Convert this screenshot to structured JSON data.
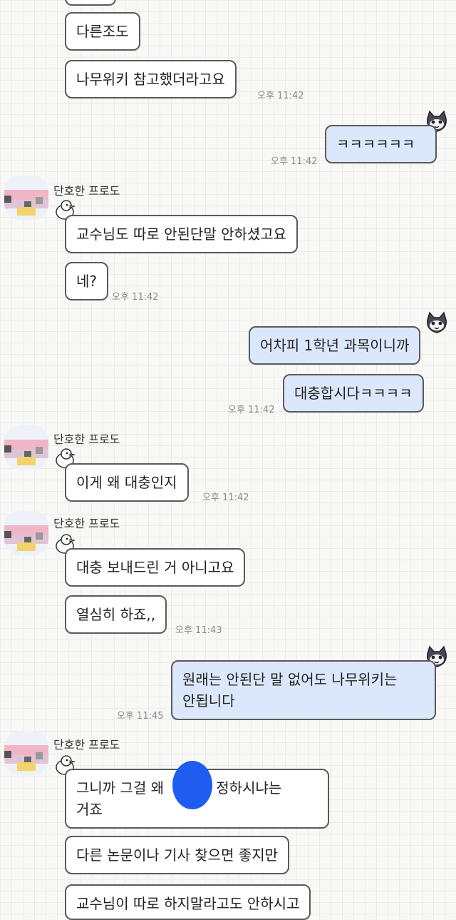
{
  "sender_name": "단호한 프로도",
  "messages": [
    {
      "text": "다른조도"
    },
    {
      "text": "나무위키 참고했더라고요",
      "time": "오후 11:42"
    },
    {
      "text": "ㅋㅋㅋㅋㅋㅋ",
      "time": "오후 11:42"
    },
    {
      "text": "교수님도 따로 안된단말 안하셨고요"
    },
    {
      "text": "네?",
      "time": "오후 11:42"
    },
    {
      "text": "어차피 1학년 과목이니까"
    },
    {
      "text": "대충합시다ㅋㅋㅋㅋ",
      "time": "오후 11:42"
    },
    {
      "text": "이게 왜 대충인지",
      "time": "오후 11:42"
    },
    {
      "text": "대충 보내드린 거 아니고요"
    },
    {
      "text": "열심히 하죠,,",
      "time": "오후 11:43"
    },
    {
      "text1": "원래는 안된단 말 없어도 나무위키는",
      "text2": "안됩니다",
      "time": "오후 11:45"
    },
    {
      "text1": "그니까 그걸 왜",
      "text1b": "님이 정하시냐는",
      "text2": "거죠"
    },
    {
      "text": "다른 논문이나 기사 찾으면 좋지만"
    },
    {
      "text": "교수님이 따로 하지말라고도 안하시고"
    }
  ]
}
